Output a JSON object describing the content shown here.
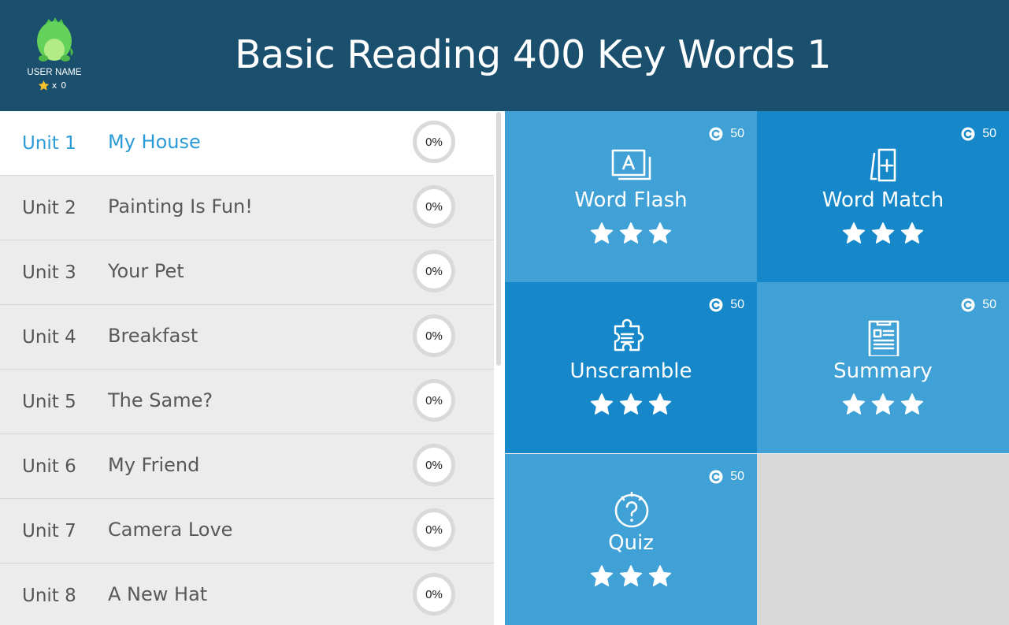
{
  "header": {
    "title": "Basic Reading 400 Key Words 1",
    "user_name": "USER NAME",
    "star_times": "x",
    "star_count": "0"
  },
  "colors": {
    "header_bg": "#1a4f6e",
    "active_unit": "#2a9bd6",
    "tile_light": "#40a1d6",
    "tile_dark": "#1688c9"
  },
  "units": [
    {
      "num": "Unit 1",
      "title": "My House",
      "progress": "0%",
      "active": true
    },
    {
      "num": "Unit 2",
      "title": "Painting Is Fun!",
      "progress": "0%"
    },
    {
      "num": "Unit 3",
      "title": "Your Pet",
      "progress": "0%"
    },
    {
      "num": "Unit 4",
      "title": "Breakfast",
      "progress": "0%"
    },
    {
      "num": "Unit 5",
      "title": "The Same?",
      "progress": "0%"
    },
    {
      "num": "Unit 6",
      "title": "My Friend",
      "progress": "0%"
    },
    {
      "num": "Unit 7",
      "title": "Camera Love",
      "progress": "0%"
    },
    {
      "num": "Unit 8",
      "title": "A New Hat",
      "progress": "0%"
    }
  ],
  "activities": [
    {
      "label": "Word Flash",
      "coins": "50",
      "icon": "flashcard-icon",
      "stars": 3
    },
    {
      "label": "Word Match",
      "coins": "50",
      "icon": "word-match-icon",
      "stars": 3
    },
    {
      "label": "Unscramble",
      "coins": "50",
      "icon": "puzzle-icon",
      "stars": 3
    },
    {
      "label": "Summary",
      "coins": "50",
      "icon": "clipboard-icon",
      "stars": 3
    },
    {
      "label": "Quiz",
      "coins": "50",
      "icon": "question-bulb-icon",
      "stars": 3
    }
  ]
}
